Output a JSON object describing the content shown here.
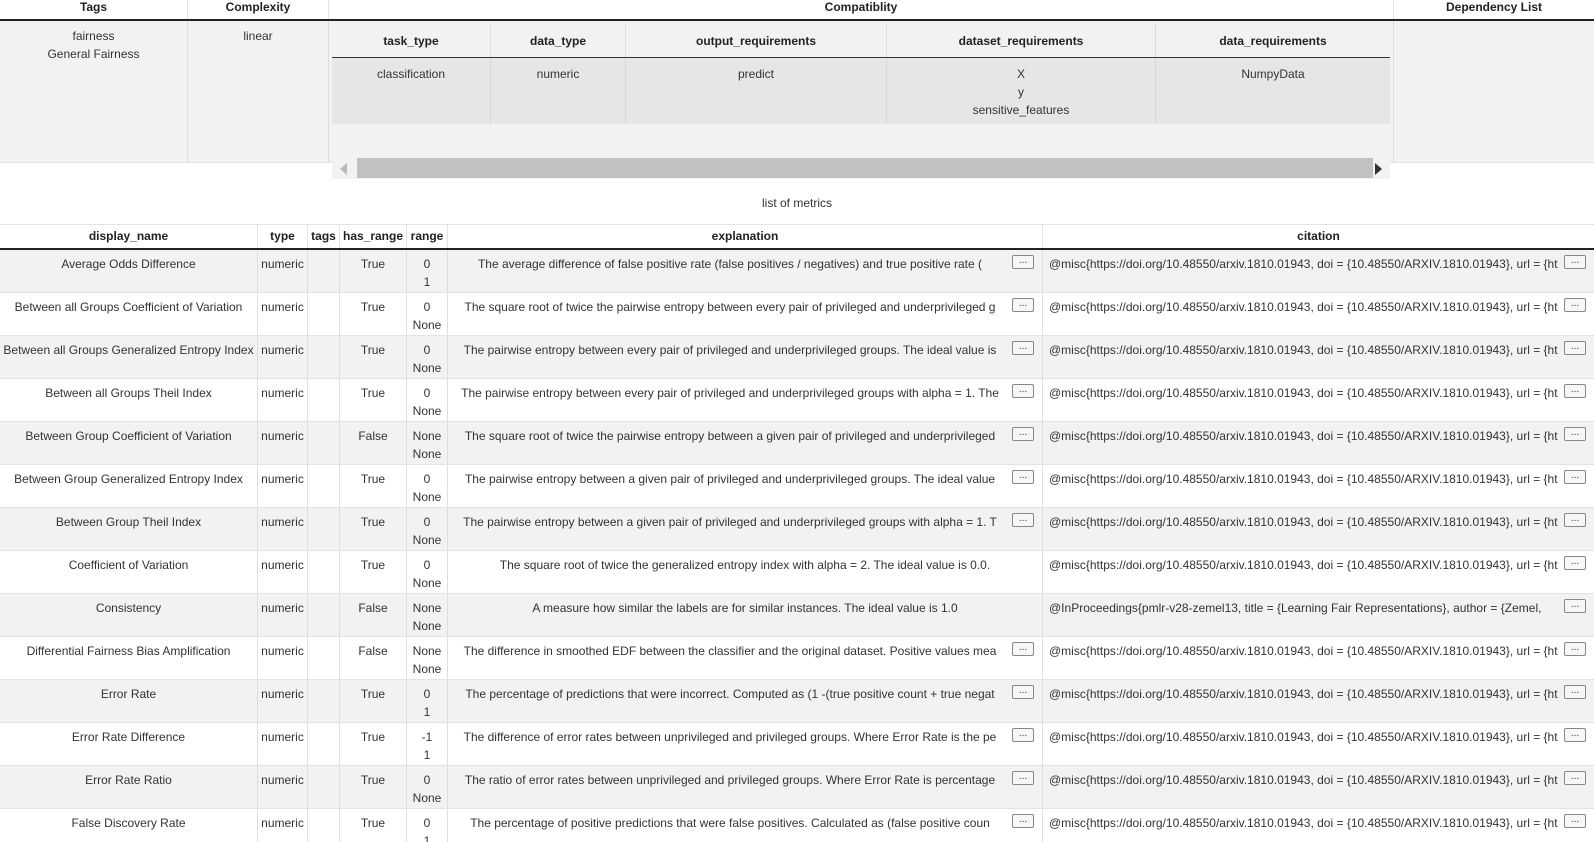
{
  "top_table": {
    "headers": {
      "tags": "Tags",
      "complexity": "Complexity",
      "compatibility": "Compatiblity",
      "dependency": "Dependency List"
    },
    "row": {
      "tags": [
        "fairness",
        "General Fairness"
      ],
      "complexity": "linear",
      "dependency": ""
    },
    "compat": {
      "headers": [
        "task_type",
        "data_type",
        "output_requirements",
        "dataset_requirements",
        "data_requirements"
      ],
      "values": {
        "task_type": "classification",
        "data_type": "numeric",
        "output_requirements": "predict",
        "dataset_requirements": [
          "X",
          "y",
          "sensitive_features"
        ],
        "data_requirements": "NumpyData"
      }
    }
  },
  "caption": "list of metrics",
  "metrics": {
    "headers": [
      "display_name",
      "type",
      "tags",
      "has_range",
      "range",
      "explanation",
      "citation"
    ],
    "more_label": "...",
    "rows": [
      {
        "display_name": "Average Odds Difference",
        "type": "numeric",
        "tags": "",
        "has_range": "True",
        "range": [
          "0",
          "1"
        ],
        "explanation": "The average difference of false positive rate (false positives / negatives) and true positive rate (",
        "citation": "@misc{https://doi.org/10.48550/arxiv.1810.01943, doi = {10.48550/ARXIV.1810.01943}, url = {ht"
      },
      {
        "display_name": "Between all Groups Coefficient of Variation",
        "type": "numeric",
        "tags": "",
        "has_range": "True",
        "range": [
          "0",
          "None"
        ],
        "explanation": "The square root of twice the pairwise entropy between every pair of privileged and underprivileged g",
        "citation": "@misc{https://doi.org/10.48550/arxiv.1810.01943, doi = {10.48550/ARXIV.1810.01943}, url = {ht"
      },
      {
        "display_name": "Between all Groups Generalized Entropy Index",
        "type": "numeric",
        "tags": "",
        "has_range": "True",
        "range": [
          "0",
          "None"
        ],
        "explanation": "The pairwise entropy between every pair of privileged and underprivileged groups. The ideal value is",
        "citation": "@misc{https://doi.org/10.48550/arxiv.1810.01943, doi = {10.48550/ARXIV.1810.01943}, url = {ht"
      },
      {
        "display_name": "Between all Groups Theil Index",
        "type": "numeric",
        "tags": "",
        "has_range": "True",
        "range": [
          "0",
          "None"
        ],
        "explanation": "The pairwise entropy between every pair of privileged and underprivileged groups with alpha = 1. The",
        "citation": "@misc{https://doi.org/10.48550/arxiv.1810.01943, doi = {10.48550/ARXIV.1810.01943}, url = {ht"
      },
      {
        "display_name": "Between Group Coefficient of Variation",
        "type": "numeric",
        "tags": "",
        "has_range": "False",
        "range": [
          "None",
          "None"
        ],
        "explanation": "The square root of twice the pairwise entropy between a given pair of privileged and underprivileged",
        "citation": "@misc{https://doi.org/10.48550/arxiv.1810.01943, doi = {10.48550/ARXIV.1810.01943}, url = {ht"
      },
      {
        "display_name": "Between Group Generalized Entropy Index",
        "type": "numeric",
        "tags": "",
        "has_range": "True",
        "range": [
          "0",
          "None"
        ],
        "explanation": "The pairwise entropy between a given pair of privileged and underprivileged groups. The ideal value",
        "citation": "@misc{https://doi.org/10.48550/arxiv.1810.01943, doi = {10.48550/ARXIV.1810.01943}, url = {ht"
      },
      {
        "display_name": "Between Group Theil Index",
        "type": "numeric",
        "tags": "",
        "has_range": "True",
        "range": [
          "0",
          "None"
        ],
        "explanation": "The pairwise entropy between a given pair of privileged and underprivileged groups with alpha = 1. T",
        "citation": "@misc{https://doi.org/10.48550/arxiv.1810.01943, doi = {10.48550/ARXIV.1810.01943}, url = {ht"
      },
      {
        "display_name": "Coefficient of Variation",
        "type": "numeric",
        "tags": "",
        "has_range": "True",
        "range": [
          "0",
          "None"
        ],
        "explanation": "The square root of twice the generalized entropy index with alpha = 2. The ideal value is 0.0.",
        "explanation_full": true,
        "citation": "@misc{https://doi.org/10.48550/arxiv.1810.01943, doi = {10.48550/ARXIV.1810.01943}, url = {ht"
      },
      {
        "display_name": "Consistency",
        "type": "numeric",
        "tags": "",
        "has_range": "False",
        "range": [
          "None",
          "None"
        ],
        "explanation": "A measure how similar the labels are for similar instances. The ideal value is 1.0",
        "explanation_full": true,
        "citation": "@InProceedings{pmlr-v28-zemel13, title = {Learning Fair Representations}, author = {Zemel,"
      },
      {
        "display_name": "Differential Fairness Bias Amplification",
        "type": "numeric",
        "tags": "",
        "has_range": "False",
        "range": [
          "None",
          "None"
        ],
        "explanation": "The difference in smoothed EDF between the classifier and the original dataset. Positive values mea",
        "citation": "@misc{https://doi.org/10.48550/arxiv.1810.01943, doi = {10.48550/ARXIV.1810.01943}, url = {ht"
      },
      {
        "display_name": "Error Rate",
        "type": "numeric",
        "tags": "",
        "has_range": "True",
        "range": [
          "0",
          "1"
        ],
        "explanation": "The percentage of predictions that were incorrect. Computed as (1 -(true positive count + true negat",
        "citation": "@misc{https://doi.org/10.48550/arxiv.1810.01943, doi = {10.48550/ARXIV.1810.01943}, url = {ht"
      },
      {
        "display_name": "Error Rate Difference",
        "type": "numeric",
        "tags": "",
        "has_range": "True",
        "range": [
          "-1",
          "1"
        ],
        "explanation": "The difference of error rates between unprivileged and privileged groups. Where Error Rate is the pe",
        "citation": "@misc{https://doi.org/10.48550/arxiv.1810.01943, doi = {10.48550/ARXIV.1810.01943}, url = {ht"
      },
      {
        "display_name": "Error Rate Ratio",
        "type": "numeric",
        "tags": "",
        "has_range": "True",
        "range": [
          "0",
          "None"
        ],
        "explanation": "The ratio of error rates between unprivileged and privileged groups. Where Error Rate is percentage",
        "citation": "@misc{https://doi.org/10.48550/arxiv.1810.01943, doi = {10.48550/ARXIV.1810.01943}, url = {ht"
      },
      {
        "display_name": "False Discovery Rate",
        "type": "numeric",
        "tags": "",
        "has_range": "True",
        "range": [
          "0",
          "1"
        ],
        "explanation": "The percentage of positive predictions that were false positives. Calculated as (false positive coun",
        "citation": "@misc{https://doi.org/10.48550/arxiv.1810.01943, doi = {10.48550/ARXIV.1810.01943}, url = {ht"
      }
    ]
  }
}
